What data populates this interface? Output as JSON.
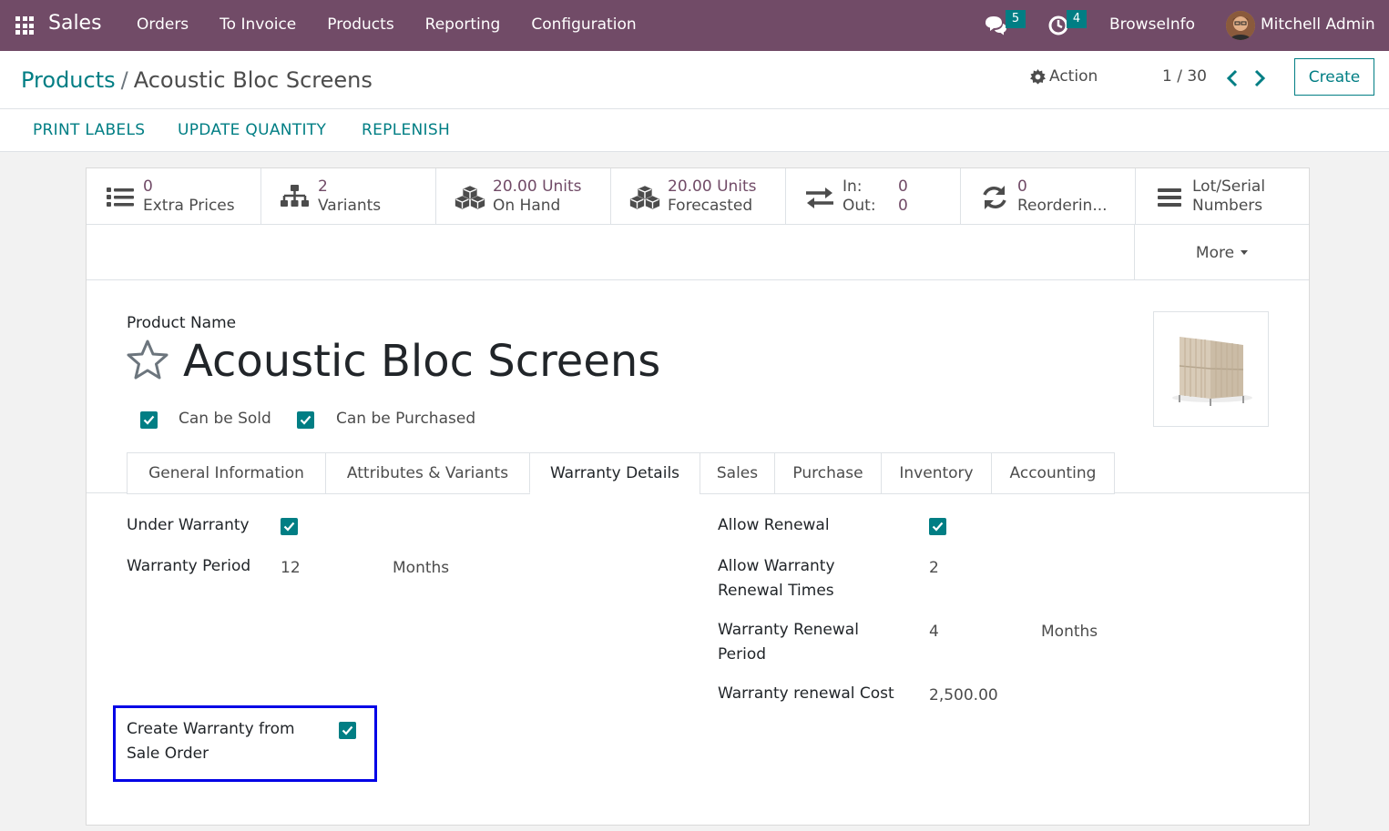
{
  "nav": {
    "app_name": "Sales",
    "menu": [
      "Orders",
      "To Invoice",
      "Products",
      "Reporting",
      "Configuration"
    ],
    "messages_count": "5",
    "activities_count": "4",
    "company": "BrowseInfo",
    "user": "Mitchell Admin"
  },
  "breadcrumb": {
    "parent": "Products",
    "separator": "/",
    "current": "Acoustic Bloc Screens"
  },
  "control": {
    "action_label": "Action",
    "pager": "1 / 30",
    "create_label": "Create"
  },
  "statusbar": {
    "buttons": [
      "PRINT LABELS",
      "UPDATE QUANTITY",
      "REPLENISH"
    ]
  },
  "smart_buttons": [
    {
      "value": "0",
      "label": "Extra Prices",
      "icon": "list-icon"
    },
    {
      "value": "2",
      "label": "Variants",
      "icon": "sitemap-icon"
    },
    {
      "value": "20.00 Units",
      "label": "On Hand",
      "icon": "cubes-icon"
    },
    {
      "value": "20.00 Units",
      "label": "Forecasted",
      "icon": "cubes-icon"
    },
    {
      "in_label": "In:",
      "in_value": "0",
      "out_label": "Out:",
      "out_value": "0",
      "icon": "exchange-icon"
    },
    {
      "value": "0",
      "label": "Reorderin...",
      "icon": "refresh-icon"
    },
    {
      "value": "Lot/Serial",
      "label": "Numbers",
      "icon": "bars-icon"
    }
  ],
  "more_label": "More",
  "product": {
    "name_label": "Product Name",
    "name": "Acoustic Bloc Screens",
    "can_be_sold_label": "Can be Sold",
    "can_be_sold": true,
    "can_be_purchased_label": "Can be Purchased",
    "can_be_purchased": true
  },
  "tabs": [
    "General Information",
    "Attributes & Variants",
    "Warranty Details",
    "Sales",
    "Purchase",
    "Inventory",
    "Accounting"
  ],
  "active_tab": "Warranty Details",
  "warranty": {
    "under_warranty_label": "Under Warranty",
    "under_warranty": true,
    "period_label": "Warranty Period",
    "period_value": "12",
    "period_unit": "Months",
    "create_from_so_label_1": "Create Warranty from",
    "create_from_so_label_2": "Sale Order",
    "create_from_so": true,
    "allow_renewal_label": "Allow Renewal",
    "allow_renewal": true,
    "renewal_times_label_1": "Allow Warranty",
    "renewal_times_label_2": "Renewal Times",
    "renewal_times_value": "2",
    "renewal_period_label_1": "Warranty Renewal",
    "renewal_period_label_2": "Period",
    "renewal_period_value": "4",
    "renewal_period_unit": "Months",
    "renewal_cost_label": "Warranty renewal Cost",
    "renewal_cost_value": "2,500.00"
  },
  "colors": {
    "navbar": "#714b67",
    "primary": "#017e84",
    "highlight_box": "#0000e6"
  }
}
